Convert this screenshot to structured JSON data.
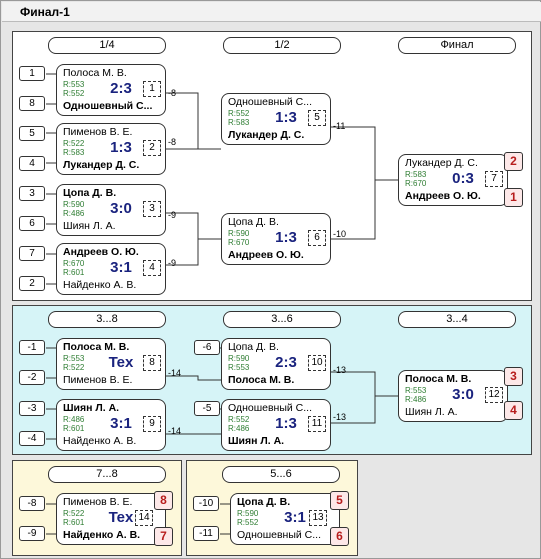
{
  "title": "Финал-1",
  "main": {
    "headers": [
      "1/4",
      "1/2",
      "Финал"
    ],
    "seeds": [
      "1",
      "8",
      "5",
      "4",
      "3",
      "6",
      "7",
      "2"
    ],
    "matches": [
      {
        "top": "Полоса М. В.",
        "bot": "Одношевный С...",
        "r1": "R:553",
        "r2": "R:552",
        "score": "2:3",
        "num": "1",
        "win": "bot",
        "loser": "-8"
      },
      {
        "top": "Пименов В. Е.",
        "bot": "Лукандер Д. С.",
        "r1": "R:522",
        "r2": "R:583",
        "score": "1:3",
        "num": "2",
        "win": "bot",
        "loser": "-8"
      },
      {
        "top": "Цопа Д. В.",
        "bot": "Шиян Л. А.",
        "r1": "R:590",
        "r2": "R:486",
        "score": "3:0",
        "num": "3",
        "win": "top",
        "loser": "-9"
      },
      {
        "top": "Андреев О. Ю.",
        "bot": "Найденко А. В.",
        "r1": "R:670",
        "r2": "R:601",
        "score": "3:1",
        "num": "4",
        "win": "top",
        "loser": "-9"
      },
      {
        "top": "Одношевный С...",
        "bot": "Лукандер Д. С.",
        "r1": "R:552",
        "r2": "R:583",
        "score": "1:3",
        "num": "5",
        "win": "bot",
        "loser": "-11"
      },
      {
        "top": "Цопа Д. В.",
        "bot": "Андреев О. Ю.",
        "r1": "R:590",
        "r2": "R:670",
        "score": "1:3",
        "num": "6",
        "win": "bot",
        "loser": "-10"
      },
      {
        "top": "Лукандер Д. С.",
        "bot": "Андреев О. Ю.",
        "r1": "R:583",
        "r2": "R:670",
        "score": "0:3",
        "num": "7",
        "win": "bot",
        "p1": "2",
        "p2": "1"
      }
    ]
  },
  "consolation": {
    "headers": [
      "3...8",
      "3...6",
      "3...4"
    ],
    "seeds": [
      "-1",
      "-2",
      "-3",
      "-4",
      "-6",
      "-5"
    ],
    "matches": [
      {
        "top": "Полоса М. В.",
        "bot": "Пименов В. Е.",
        "r1": "R:553",
        "r2": "R:522",
        "score": "Tex",
        "num": "8",
        "win": "top",
        "loser": "-14"
      },
      {
        "top": "Шиян Л. А.",
        "bot": "Найденко А. В.",
        "r1": "R:486",
        "r2": "R:601",
        "score": "3:1",
        "num": "9",
        "win": "top",
        "loser": "-14"
      },
      {
        "top": "Цопа Д. В.",
        "bot": "Полоса М. В.",
        "r1": "R:590",
        "r2": "R:553",
        "score": "2:3",
        "num": "10",
        "win": "bot",
        "loser": "-13"
      },
      {
        "top": "Одношевный С...",
        "bot": "Шиян Л. А.",
        "r1": "R:552",
        "r2": "R:486",
        "score": "1:3",
        "num": "11",
        "win": "bot",
        "loser": "-13"
      },
      {
        "top": "Полоса М. В.",
        "bot": "Шиян Л. А.",
        "r1": "R:553",
        "r2": "R:486",
        "score": "3:0",
        "num": "12",
        "win": "top",
        "p1": "3",
        "p2": "4"
      }
    ]
  },
  "p78": {
    "header": "7...8",
    "seeds": [
      "-8",
      "-9"
    ],
    "match": {
      "top": "Пименов В. Е.",
      "bot": "Найденко А. В.",
      "r1": "R:522",
      "r2": "R:601",
      "score": "Tex",
      "num": "14",
      "win": "bot",
      "p1": "8",
      "p2": "7"
    }
  },
  "p56": {
    "header": "5...6",
    "seeds": [
      "-10",
      "-11"
    ],
    "match": {
      "top": "Цопа Д. В.",
      "bot": "Одношевный С...",
      "r1": "R:590",
      "r2": "R:552",
      "score": "3:1",
      "num": "13",
      "win": "top",
      "p1": "5",
      "p2": "6"
    }
  }
}
